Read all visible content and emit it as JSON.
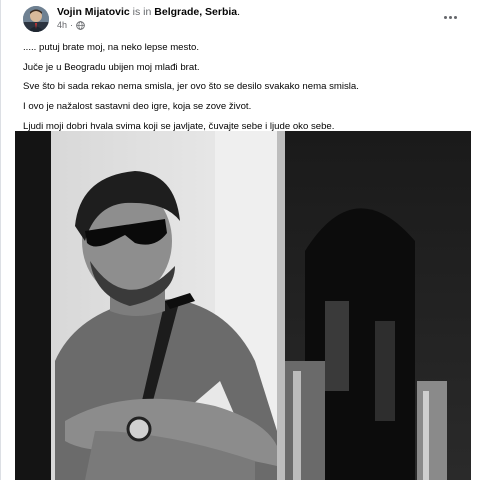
{
  "post": {
    "author": "Vojin Mijatovic",
    "is_in": "is in",
    "location": "Belgrade, Serbia",
    "location_suffix": ".",
    "time": "4h",
    "separator": "·",
    "privacy_icon": "globe-icon",
    "more_icon": "more-options-icon",
    "lines": [
      "..... putuj brate moj, na neko lepse mesto.",
      "Juče je u Beogradu ubijen moj mlađi brat.",
      "Sve što bi sada rekao nema smisla, jer ovo što se desilo svakako nema smisla.",
      "I ovo je nažalost sastavni deo igre, koja se zove život.",
      "Ljudi moji dobri hvala svima koji se javljate, čuvajte sebe i ljude oko sebe."
    ]
  },
  "photo": {
    "description_icon": "photo-image",
    "tone": "black-and-white"
  }
}
